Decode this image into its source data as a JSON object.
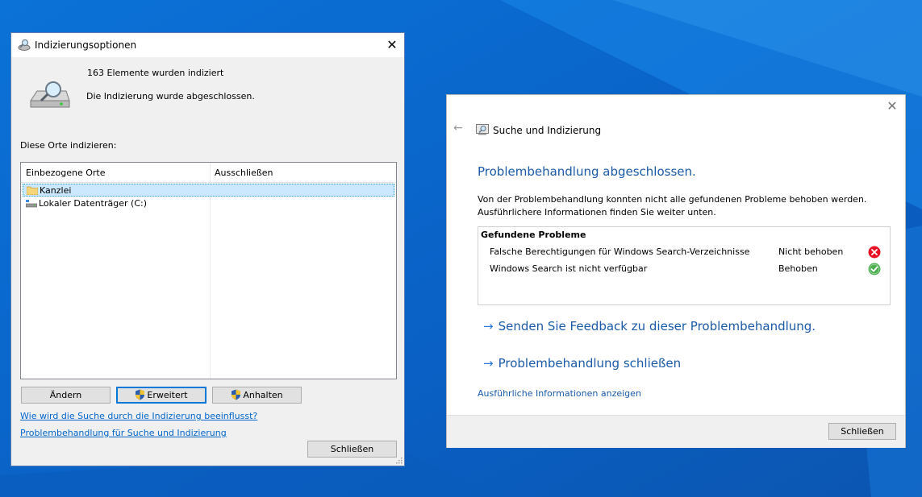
{
  "indexing_dialog": {
    "title": "Indizierungsoptionen",
    "items_indexed": "163 Elemente wurden indiziert",
    "status": "Die Indizierung wurde abgeschlossen.",
    "locations_label": "Diese Orte indizieren:",
    "columns": [
      "Einbezogene Orte",
      "Ausschließen"
    ],
    "locations": [
      {
        "name": "Kanzlei",
        "icon": "folder-icon"
      },
      {
        "name": "Lokaler Datenträger (C:)",
        "icon": "drive-icon"
      }
    ],
    "buttons": {
      "modify": "Ändern",
      "advanced": "Erweitert",
      "pause": "Anhalten",
      "close": "Schließen"
    },
    "links": {
      "search_influence": "Wie wird die Suche durch die Indizierung beeinflusst?",
      "troubleshoot": "Problembehandlung für Suche und Indizierung"
    }
  },
  "troubleshooter_dialog": {
    "title": "Suche und Indizierung",
    "heading": "Problembehandlung abgeschlossen.",
    "text_line1": "Von der Problembehandlung konnten nicht alle gefundenen Probleme behoben werden.",
    "text_line2": "Ausführlichere Informationen finden Sie weiter unten.",
    "problems_header": "Gefundene Probleme",
    "problems": [
      {
        "name": "Falsche Berechtigungen für Windows Search-Verzeichnisse",
        "status": "Nicht behoben",
        "icon": "error-icon"
      },
      {
        "name": "Windows Search ist nicht verfügbar",
        "status": "Behoben",
        "icon": "success-icon"
      }
    ],
    "actions": {
      "feedback": "Senden Sie Feedback zu dieser Problembehandlung.",
      "close_troubleshooter": "Problembehandlung schließen"
    },
    "details_link": "Ausführliche Informationen anzeigen",
    "close_button": "Schließen"
  },
  "colors": {
    "desktop": "#0a66cc",
    "accent": "#0078d7",
    "link": "#1a5aa8",
    "error": "#e81123",
    "success": "#4caf50"
  }
}
